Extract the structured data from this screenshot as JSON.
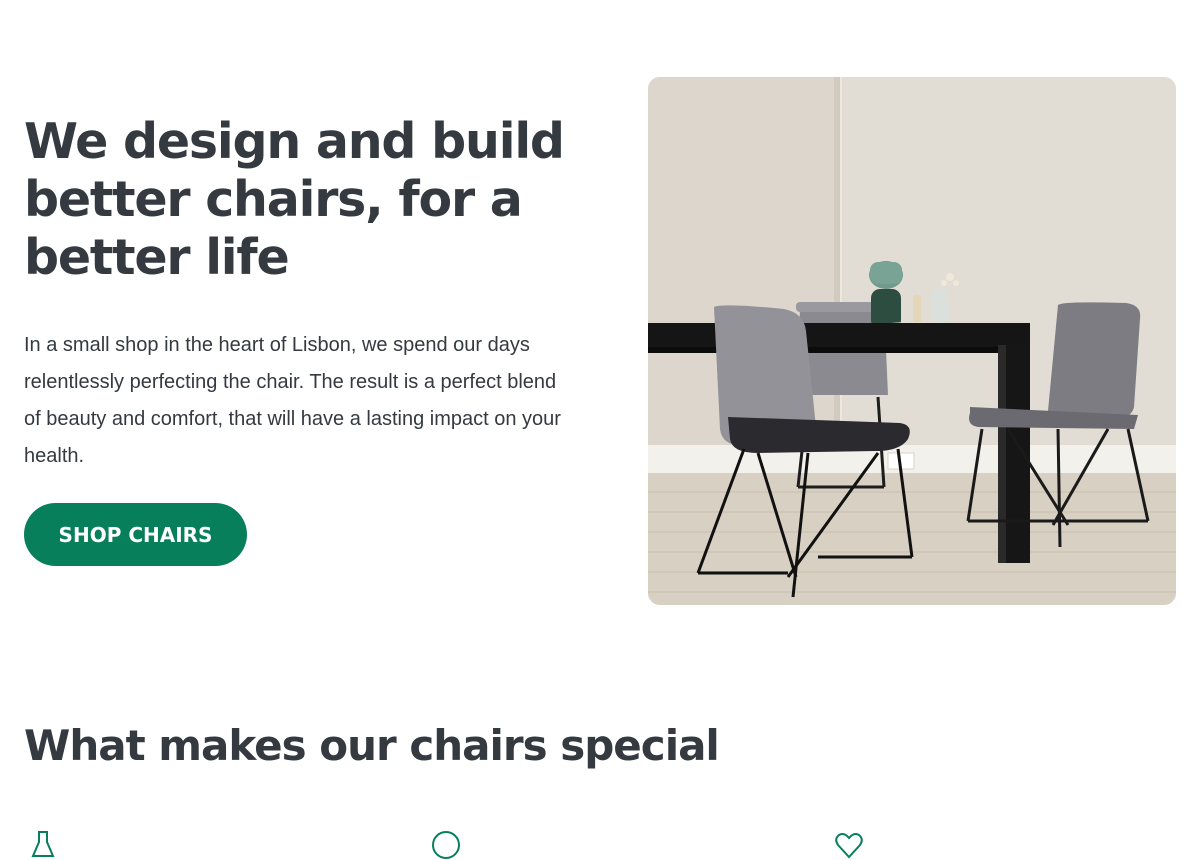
{
  "hero": {
    "title": "We design and build better chairs, for a better life",
    "description": "In a small shop in the heart of Lisbon, we spend our days relentlessly perfecting the chair. The result is a perfect blend of beauty and comfort, that will have a lasting impact on your health.",
    "cta_label": "SHOP CHAIRS",
    "image": "dining-table-with-grey-chairs"
  },
  "features": {
    "title": "What makes our chairs special",
    "icons": [
      "flask-icon",
      "circle-icon",
      "heart-icon"
    ]
  },
  "colors": {
    "accent": "#087f5b",
    "text": "#343a40",
    "background": "#ffffff"
  }
}
